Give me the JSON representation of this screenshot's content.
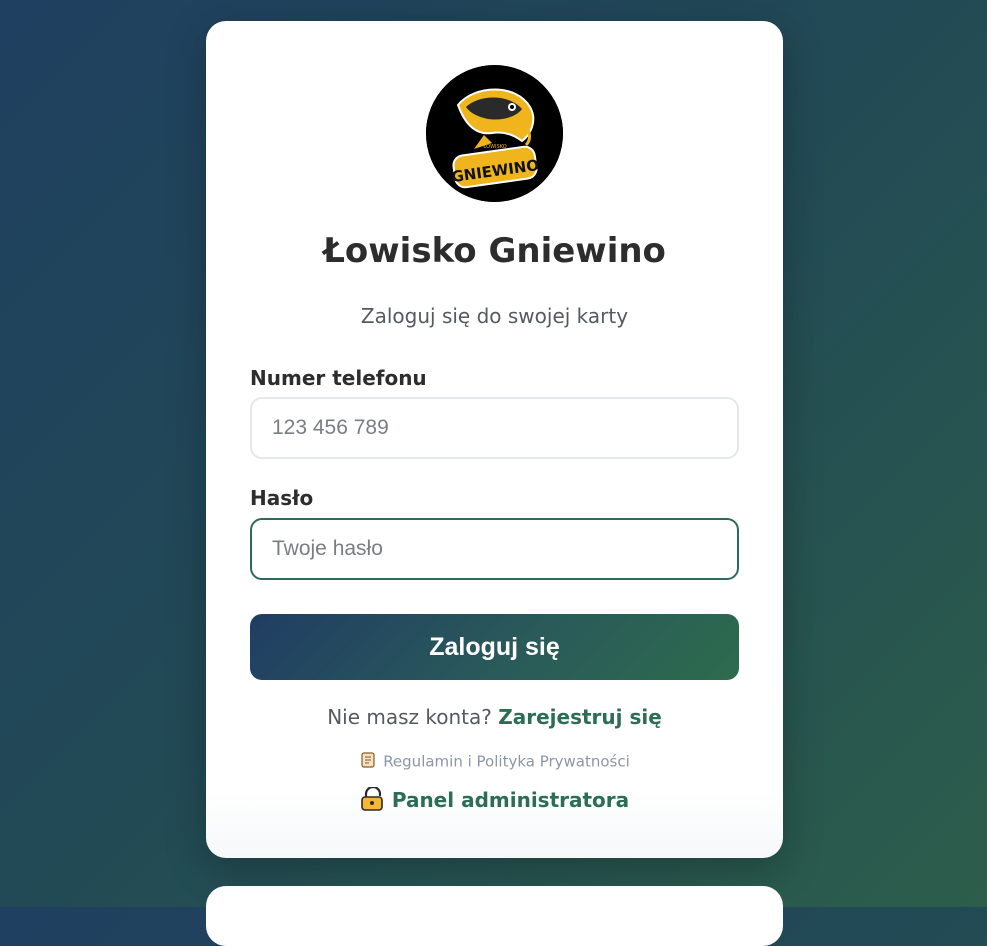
{
  "brand": {
    "title": "Łowisko Gniewino",
    "subtitle": "Zaloguj się do swojej karty",
    "logo_text_small": "ŁOWISKO",
    "logo_text_big": "GNIEWINO"
  },
  "form": {
    "phone_label": "Numer telefonu",
    "phone_placeholder": "123 456 789",
    "phone_value": "",
    "password_label": "Hasło",
    "password_placeholder": "Twoje hasło",
    "password_value": "",
    "submit_label": "Zaloguj się"
  },
  "footer": {
    "no_account_text": "Nie masz konta?",
    "register_link": "Zarejestruj się",
    "terms_icon": "scroll-icon",
    "terms_link": "Regulamin i Polityka Prywatności",
    "admin_icon": "lock-icon",
    "admin_link": "Panel administratora"
  },
  "colors": {
    "accent": "#2c6e54",
    "button_start": "#203d63",
    "button_end": "#2d6b4d",
    "focus_border": "#2e6b56"
  }
}
